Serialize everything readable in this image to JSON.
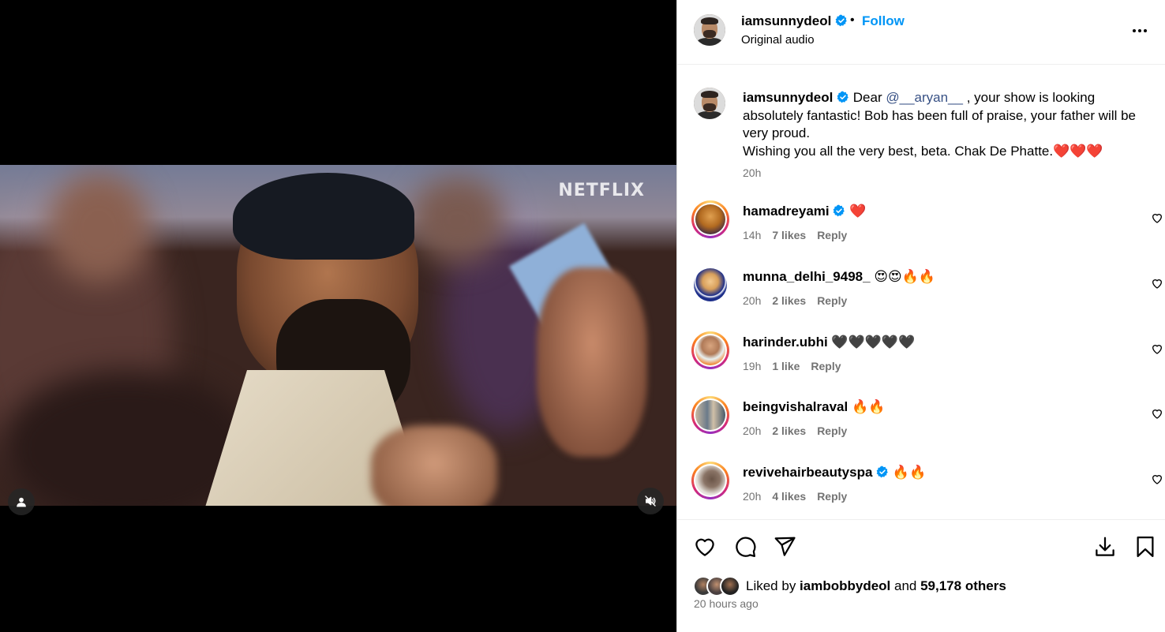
{
  "video": {
    "watermark": "NETFLIX"
  },
  "header": {
    "username": "iamsunnydeol",
    "follow_label": "Follow",
    "separator": "•",
    "audio": "Original audio"
  },
  "caption": {
    "username": "iamsunnydeol",
    "prefix": "Dear ",
    "mention": "@__aryan__",
    "text": " , your show is looking absolutely fantastic! Bob has been full of praise, your father will be very proud.",
    "line2": "Wishing you all the very best, beta. Chak De Phatte.❤️❤️❤️",
    "time": "20h"
  },
  "comments": [
    {
      "username": "hamadreyami",
      "verified": true,
      "text": "❤️",
      "time": "14h",
      "likes": "7 likes",
      "reply": "Reply"
    },
    {
      "username": "munna_delhi_9498_",
      "verified": false,
      "text": "😍😍🔥🔥",
      "time": "20h",
      "likes": "2 likes",
      "reply": "Reply"
    },
    {
      "username": "harinder.ubhi",
      "verified": false,
      "text": "🖤🖤🖤🖤🖤",
      "time": "19h",
      "likes": "1 like",
      "reply": "Reply"
    },
    {
      "username": "beingvishalraval",
      "verified": false,
      "text": "🔥🔥",
      "time": "20h",
      "likes": "2 likes",
      "reply": "Reply"
    },
    {
      "username": "revivehairbeautyspa",
      "verified": true,
      "text": "🔥🔥",
      "time": "20h",
      "likes": "4 likes",
      "reply": "Reply"
    }
  ],
  "likes": {
    "prefix": "Liked by ",
    "user": "iambobbydeol",
    "middle": " and ",
    "others": "59,178 others"
  },
  "posted": "20 hours ago",
  "colors": {
    "accent": "#0095f6",
    "verified": "#0095f6",
    "muted": "#737373",
    "mention": "#385185"
  },
  "icons": [
    "verified-badge-icon",
    "more-options-icon",
    "heart-icon",
    "comment-icon",
    "share-icon",
    "download-icon",
    "bookmark-icon",
    "tag-user-icon",
    "mute-icon"
  ]
}
